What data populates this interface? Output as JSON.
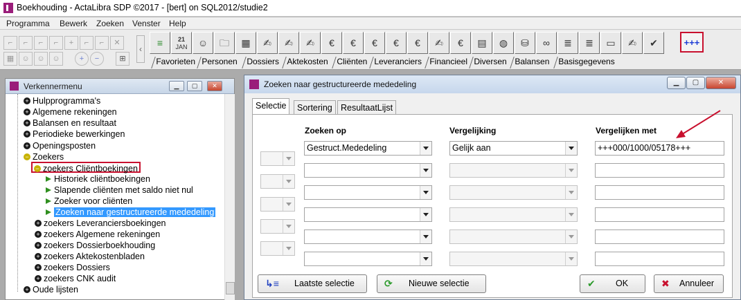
{
  "window": {
    "title": "Boekhouding - ActaLibra  SDP ©2017 - [bert]  on  SQL2012/studie2"
  },
  "menu": [
    "Programma",
    "Bewerk",
    "Zoeken",
    "Venster",
    "Help"
  ],
  "toolbar": {
    "calendar_day": "21",
    "calendar_month": "JAN",
    "highlighted_button": "+++"
  },
  "nav_tabs": [
    "Favorieten",
    "Personen",
    "Dossiers",
    "Aktekosten",
    "Cliënten",
    "Leveranciers",
    "Financieel",
    "Diversen",
    "Balansen",
    "Basisgegevens"
  ],
  "explorer": {
    "title": "Verkennermenu",
    "items": [
      "Hulpprogramma's",
      "Algemene rekeningen",
      "Balansen en resultaat",
      "Periodieke bewerkingen",
      "Openingsposten",
      "Zoekers",
      "zoekers Cliëntboekingen",
      "Historiek cliëntboekingen",
      "Slapende cliënten met saldo niet nul",
      "Zoeker voor cliënten",
      "Zoeken naar gestructureerde mededeling",
      "zoekers Leveranciersboekingen",
      "zoekers Algemene rekeningen",
      "zoekers Dossierboekhouding",
      "zoekers Aktekostenbladen",
      "zoekers Dossiers",
      "zoekers CNK audit",
      "Oude lijsten"
    ]
  },
  "dialog": {
    "title": "Zoeken naar gestructureerde mededeling",
    "tabs": [
      "Selectie",
      "Sortering",
      "ResultaatLijst"
    ],
    "columns": {
      "search_on": "Zoeken op",
      "comparison": "Vergelijking",
      "compare_with": "Vergelijken met"
    },
    "row1": {
      "search_on": "Gestruct.Mededeling",
      "comparison": "Gelijk aan",
      "compare_with": "+++000/1000/05178+++"
    },
    "buttons": {
      "last_selection": "Laatste selectie",
      "new_selection": "Nieuwe selectie",
      "ok": "OK",
      "cancel": "Annuleer"
    }
  },
  "colors": {
    "highlight_red": "#c8102e",
    "selection_blue": "#3399ff",
    "brand_purple": "#9a1d7a"
  }
}
